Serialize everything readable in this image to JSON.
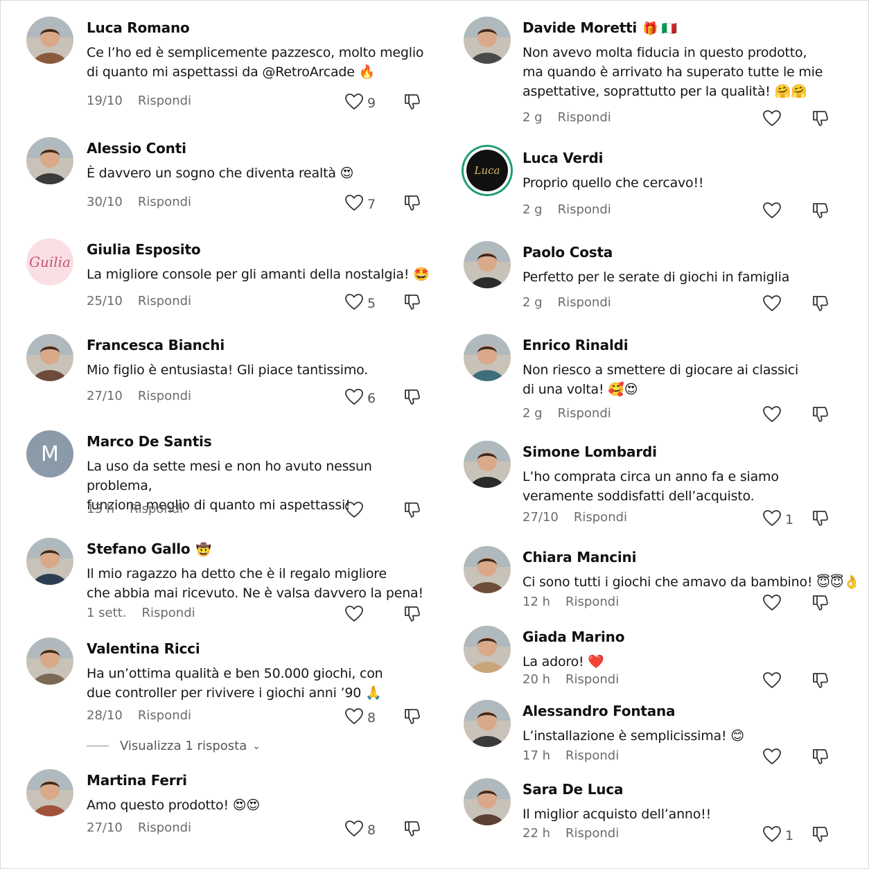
{
  "reply_label": "Rispondi",
  "left": [
    {
      "name": "Luca Romano",
      "badge": "",
      "text": "Ce l’ho ed è semplicemente pazzesco, molto meglio\ndi quanto mi aspettassi da @RetroArcade 🔥",
      "date": "19/10",
      "likes": "9"
    },
    {
      "name": "Alessio Conti",
      "badge": "",
      "text": "È davvero un sogno che diventa realtà 😍",
      "date": "30/10",
      "likes": "7"
    },
    {
      "name": "Giulia Esposito",
      "badge": "",
      "avatar_text": "Guilia",
      "text": "La migliore console per gli amanti della nostalgia! 🤩",
      "date": "25/10",
      "likes": "5"
    },
    {
      "name": "Francesca Bianchi",
      "badge": "",
      "text": "Mio figlio è entusiasta! Gli piace tantissimo.",
      "date": "27/10",
      "likes": "6"
    },
    {
      "name": "Marco De Santis",
      "badge": "",
      "avatar_text": "M",
      "text": "La uso da sette mesi e non ho avuto nessun problema,\nfunziona meglio di quanto mi aspettassi!",
      "date": "13 h",
      "likes": ""
    },
    {
      "name": "Stefano Gallo",
      "badge": "🤠",
      "text": "Il mio ragazzo ha detto che è il regalo migliore\nche abbia mai ricevuto. Ne è valsa davvero la pena!",
      "date": "1 sett.",
      "likes": ""
    },
    {
      "name": "Valentina Ricci",
      "badge": "",
      "text": "Ha un’ottima qualità e ben 50.000 giochi, con\ndue controller per rivivere i giochi anni ’90 🙏",
      "date": "28/10",
      "likes": "8",
      "replies": "Visualizza 1 risposta"
    },
    {
      "name": "Martina Ferri",
      "badge": "",
      "text": "Amo questo prodotto! 😍😍",
      "date": "27/10",
      "likes": "8"
    }
  ],
  "right": [
    {
      "name": "Davide Moretti",
      "badge": "🎁 🇮🇹",
      "text": "Non avevo molta fiducia in questo prodotto,\nma quando è arrivato ha superato tutte le mie\naspettative, soprattutto per la qualità! 🤗🤗",
      "date": "2 g",
      "likes": ""
    },
    {
      "name": "Luca Verdi",
      "badge": "",
      "avatar_text": "Luca",
      "text": "Proprio quello che cercavo!!",
      "date": "2 g",
      "likes": ""
    },
    {
      "name": "Paolo Costa",
      "badge": "",
      "text": "Perfetto per le serate di giochi in famiglia",
      "date": "2 g",
      "likes": ""
    },
    {
      "name": "Enrico Rinaldi",
      "badge": "",
      "text": "Non riesco a smettere di giocare ai classici\ndi una volta! 🥰😍",
      "date": "2 g",
      "likes": ""
    },
    {
      "name": "Simone Lombardi",
      "badge": "",
      "text": "L’ho comprata circa un anno fa e siamo\nveramente soddisfatti dell’acquisto.",
      "date": "27/10",
      "likes": "1"
    },
    {
      "name": "Chiara Mancini",
      "badge": "",
      "text": "Ci sono tutti i giochi che amavo da bambino! 😇😇👌",
      "date": "12 h",
      "likes": ""
    },
    {
      "name": "Giada Marino",
      "badge": "",
      "text": "La adoro! ❤️",
      "date": "20 h",
      "likes": ""
    },
    {
      "name": "Alessandro Fontana",
      "badge": "",
      "text": "L’installazione è semplicissima! 😊",
      "date": "17 h",
      "likes": ""
    },
    {
      "name": "Sara De Luca",
      "badge": "",
      "text": "Il miglior acquisto dell’anno!!",
      "date": "22 h",
      "likes": "1"
    }
  ],
  "colors": {
    "text": "#111111",
    "meta": "#6b6b6b",
    "badge_m": "#8a9aa8",
    "luca_ring": "#1f9e6e",
    "giulia_bg": "#f9dfe3",
    "giulia_text": "#c0567a"
  }
}
